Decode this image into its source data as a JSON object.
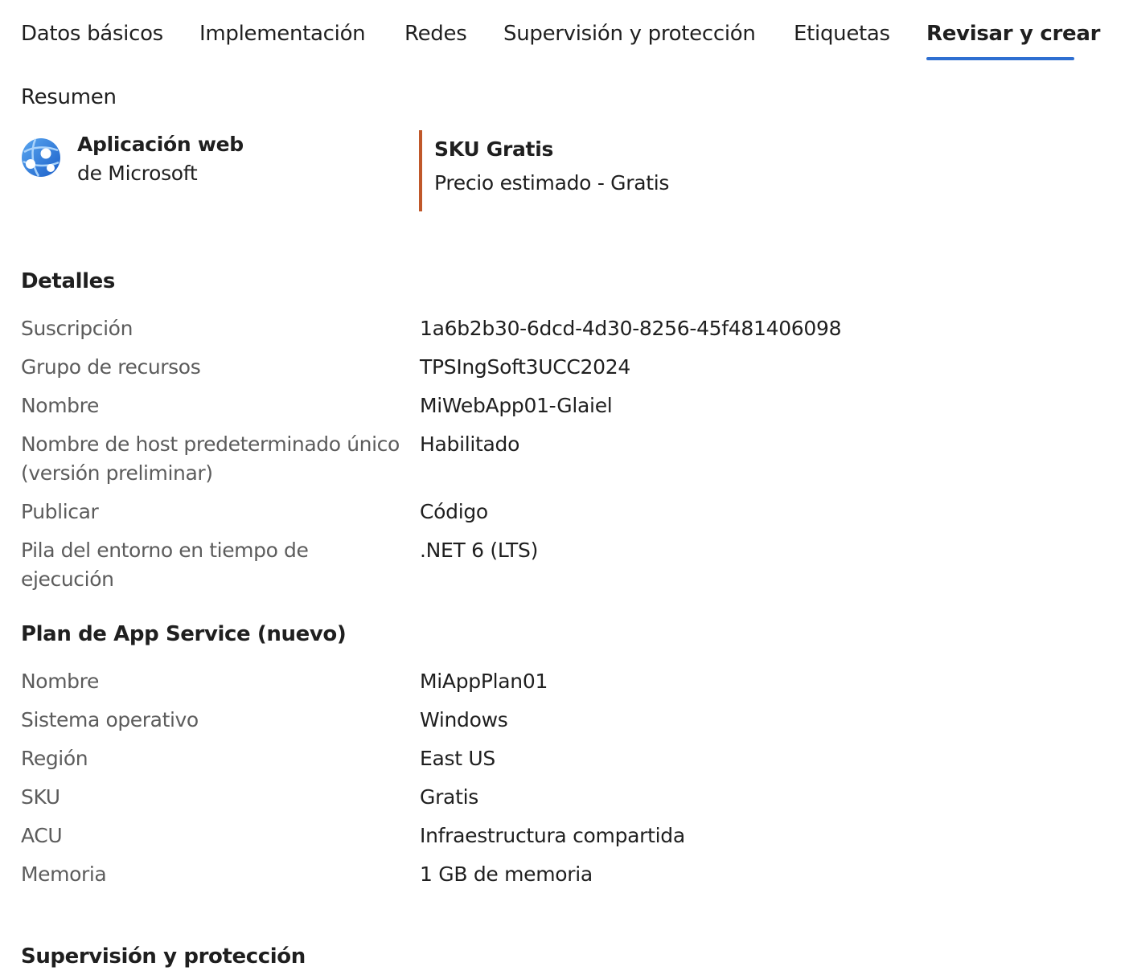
{
  "tabs": [
    {
      "label": "Datos básicos"
    },
    {
      "label": "Implementación"
    },
    {
      "label": "Redes"
    },
    {
      "label": "Supervisión y protección"
    },
    {
      "label": "Etiquetas"
    },
    {
      "label": "Revisar y crear",
      "active": true
    }
  ],
  "summary": {
    "heading": "Resumen",
    "product": {
      "name": "Aplicación web",
      "publisher": "de Microsoft",
      "icon": "web-app-globe-icon"
    },
    "sku": {
      "title": "SKU Gratis",
      "price": "Precio estimado - Gratis"
    }
  },
  "details": {
    "title": "Detalles",
    "rows": [
      {
        "label": "Suscripción",
        "value": "1a6b2b30-6dcd-4d30-8256-45f481406098"
      },
      {
        "label": "Grupo de recursos",
        "value": "TPSIngSoft3UCC2024"
      },
      {
        "label": "Nombre",
        "value": "MiWebApp01-Glaiel"
      },
      {
        "label": "Nombre de host predeterminado único (versión preliminar)",
        "value": "Habilitado"
      },
      {
        "label": "Publicar",
        "value": "Código"
      },
      {
        "label": "Pila del entorno en tiempo de ejecución",
        "value": ".NET 6 (LTS)"
      }
    ]
  },
  "plan": {
    "title": "Plan de App Service (nuevo)",
    "rows": [
      {
        "label": "Nombre",
        "value": "MiAppPlan01"
      },
      {
        "label": "Sistema operativo",
        "value": "Windows"
      },
      {
        "label": "Región",
        "value": "East US"
      },
      {
        "label": "SKU",
        "value": "Gratis"
      },
      {
        "label": "ACU",
        "value": "Infraestructura compartida"
      },
      {
        "label": "Memoria",
        "value": "1 GB de memoria"
      }
    ]
  },
  "monitoring": {
    "title": "Supervisión y protección"
  },
  "colors": {
    "accent": "#2f6fd1",
    "sku_bar": "#c0582a",
    "label_text": "#5c5c5c"
  }
}
